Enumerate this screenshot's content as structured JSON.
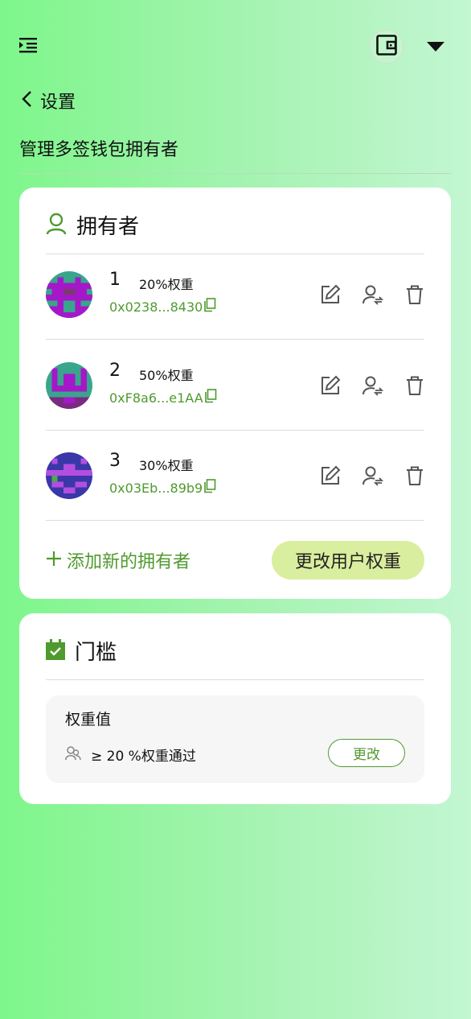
{
  "header": {
    "menu_icon": "menu-indent-icon",
    "wallet_icon": "wallet-icon",
    "dropdown_icon": "caret-down-icon"
  },
  "nav": {
    "back_label": "设置",
    "page_title": "管理多签钱包拥有者"
  },
  "owners_card": {
    "title": "拥有者",
    "owners": [
      {
        "index": "1",
        "weight": "20%权重",
        "address": "0x0238...8430"
      },
      {
        "index": "2",
        "weight": "50%权重",
        "address": "0xF8a6...e1AA"
      },
      {
        "index": "3",
        "weight": "30%权重",
        "address": "0x03Eb...89b9"
      }
    ],
    "add_owner_label": "添加新的拥有者",
    "change_weight_label": "更改用户权重"
  },
  "threshold_card": {
    "title": "门槛",
    "weight_label": "权重值",
    "rule_text": "≥ 20 %权重通过",
    "change_label": "更改"
  },
  "colors": {
    "accent_green": "#4f9a2e",
    "button_yellow_green": "#daee9f",
    "background_start": "#7ef68b",
    "background_end": "#c3f6d2"
  }
}
